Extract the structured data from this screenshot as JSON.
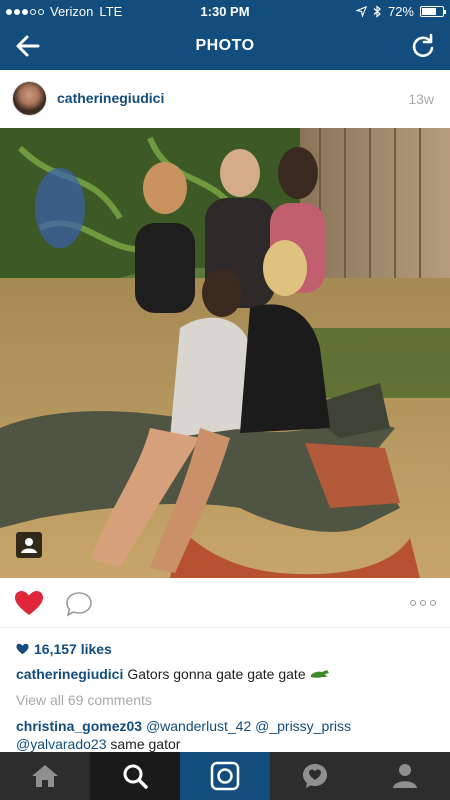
{
  "status_bar": {
    "carrier": "Verizon",
    "network": "LTE",
    "time": "1:30 PM",
    "battery": "72%",
    "battery_level": 0.72
  },
  "nav": {
    "title": "PHOTO",
    "back_icon": "back-arrow-icon",
    "refresh_icon": "refresh-icon"
  },
  "post": {
    "username": "catherinegiudici",
    "age": "13w"
  },
  "actions": {
    "liked": true,
    "heart_color": "#e0263b"
  },
  "likes": "16,157 likes",
  "caption": {
    "username": "catherinegiudici",
    "text": "Gators gonna gate gate gate"
  },
  "view_all": "View all 69 comments",
  "comments": [
    {
      "username": "christina_gomez03",
      "mention1": "@wanderlust_42",
      "mention2": "@_prissy_priss",
      "mention3": "@yalvarado23",
      "text": "same gator"
    }
  ],
  "tabs": [
    "home",
    "explore",
    "camera",
    "activity",
    "profile"
  ],
  "colors": {
    "brand": "#124d7d",
    "tab_bar": "#2d2d2d",
    "muted": "#a9a9a9"
  }
}
